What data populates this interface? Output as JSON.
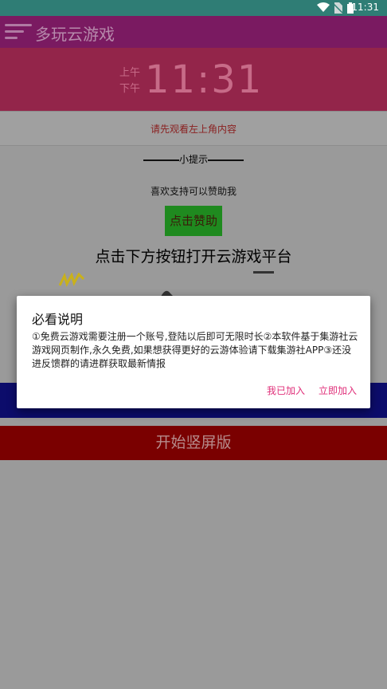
{
  "status_bar": {
    "time": "11:31"
  },
  "app_bar": {
    "title": "多玩云游戏"
  },
  "clock": {
    "am": "上午",
    "pm": "下午",
    "time": "11:31"
  },
  "notice": "请先观看左上角内容",
  "tip": "小提示",
  "support_text": "喜欢支持可以赞助我",
  "donate_button": "点击赞助",
  "headline": "点击下方按钮打开云游戏平台",
  "portrait_button": "开始竖屏版",
  "dialog": {
    "title": "必看说明",
    "body": "①免费云游戏需要注册一个账号,登陆以后即可无限时长②本软件基于集游社云游戏网页制作,永久免费,如果想获得更好的云游体验请下载集游社APP③还没进反馈群的请进群获取最新情报",
    "button_joined": "我已加入",
    "button_join_now": "立即加入"
  },
  "colors": {
    "accent": "#e0307a",
    "app_bar": "#7a1a61",
    "clock_bg": "#93254a"
  }
}
